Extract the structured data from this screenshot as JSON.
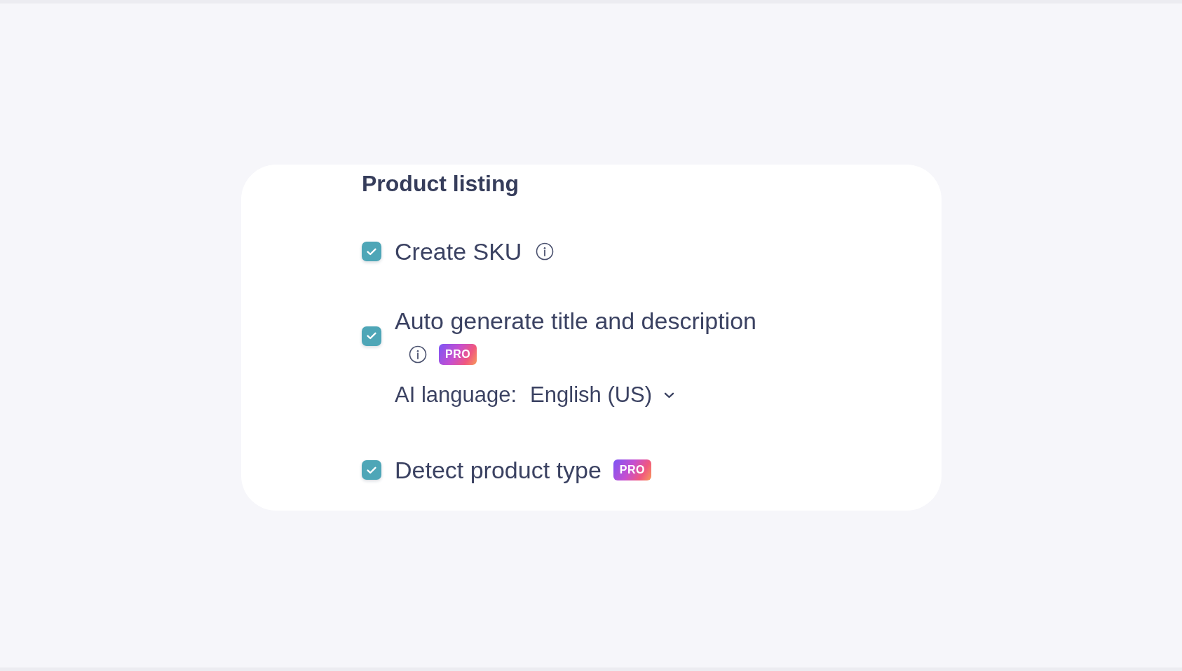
{
  "section": {
    "title": "Product listing",
    "options": [
      {
        "label": "Create SKU",
        "checked": true,
        "info": true
      },
      {
        "label": "Auto generate title and description",
        "checked": true,
        "info": true,
        "badge": "PRO",
        "setting": {
          "label": "AI language:",
          "value": "English (US)"
        }
      },
      {
        "label": "Detect product type",
        "checked": true,
        "info": false,
        "badge": "PRO"
      }
    ]
  }
}
